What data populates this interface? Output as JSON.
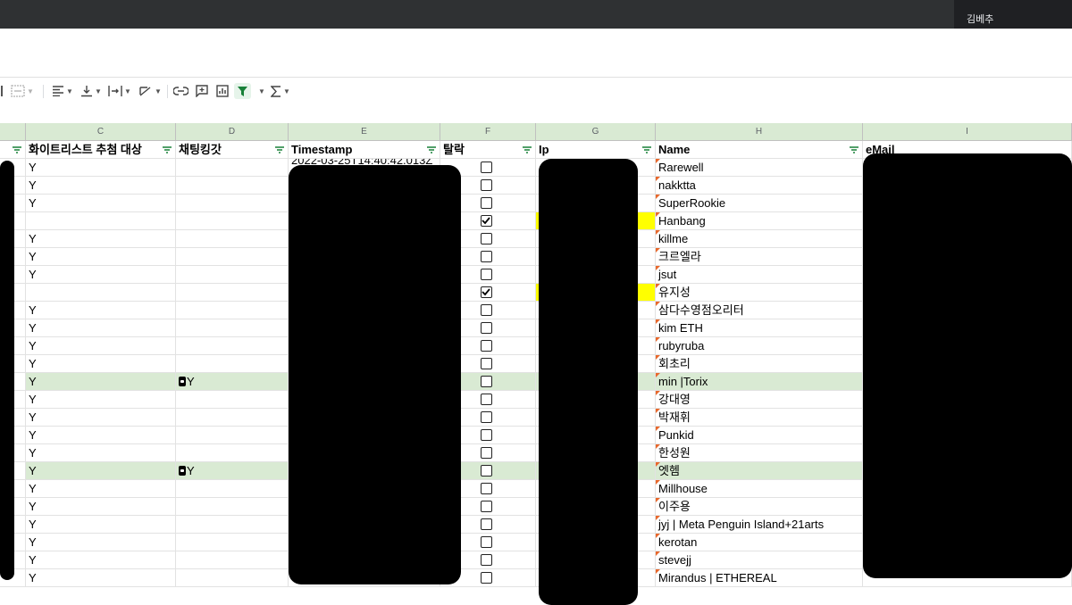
{
  "user": {
    "name": "김베추"
  },
  "columns": {
    "letters": [
      "C",
      "D",
      "E",
      "F",
      "G",
      "H",
      "I"
    ]
  },
  "headers": {
    "c": "화이트리스트 추첨 대상",
    "d": "채팅킹갓",
    "e": "Timestamp",
    "f": "탈락",
    "g": "Ip",
    "h": "Name",
    "i": "eMail"
  },
  "timestamp_partial": "2022-03-25T14:40:42.013Z",
  "rows": [
    {
      "c": "Y",
      "d": "",
      "f": false,
      "name": "Rarewell",
      "hl": ""
    },
    {
      "c": "Y",
      "d": "",
      "f": false,
      "name": "nakktta",
      "hl": ""
    },
    {
      "c": "Y",
      "d": "",
      "f": false,
      "name": "SuperRookie",
      "hl": ""
    },
    {
      "c": "",
      "d": "",
      "f": true,
      "name": "Hanbang",
      "hl": "yellow"
    },
    {
      "c": "Y",
      "d": "",
      "f": false,
      "name": "killme",
      "hl": ""
    },
    {
      "c": "Y",
      "d": "",
      "f": false,
      "name": "크르엘라",
      "hl": ""
    },
    {
      "c": "Y",
      "d": "",
      "f": false,
      "name": "jsut",
      "hl": ""
    },
    {
      "c": "",
      "d": "",
      "f": true,
      "name": "유지성",
      "hl": "yellow"
    },
    {
      "c": "Y",
      "d": "",
      "f": false,
      "name": "삼다수영점오리터",
      "hl": ""
    },
    {
      "c": "Y",
      "d": "",
      "f": false,
      "name": "kim ETH",
      "hl": ""
    },
    {
      "c": "Y",
      "d": "",
      "f": false,
      "name": "rubyruba",
      "hl": ""
    },
    {
      "c": "Y",
      "d": "",
      "f": false,
      "name": "회초리",
      "hl": ""
    },
    {
      "c": "Y",
      "d": "Y",
      "f": false,
      "name": "min |Torix",
      "hl": "green"
    },
    {
      "c": "Y",
      "d": "",
      "f": false,
      "name": "강대영",
      "hl": ""
    },
    {
      "c": "Y",
      "d": "",
      "f": false,
      "name": "박재휘",
      "hl": ""
    },
    {
      "c": "Y",
      "d": "",
      "f": false,
      "name": "Punkid",
      "hl": ""
    },
    {
      "c": "Y",
      "d": "",
      "f": false,
      "name": "한성원",
      "hl": ""
    },
    {
      "c": "Y",
      "d": "Y",
      "f": false,
      "name": "엣헴",
      "hl": "green"
    },
    {
      "c": "Y",
      "d": "",
      "f": false,
      "name": "Millhouse",
      "hl": ""
    },
    {
      "c": "Y",
      "d": "",
      "f": false,
      "name": "이주용",
      "hl": ""
    },
    {
      "c": "Y",
      "d": "",
      "f": false,
      "name": "jyj | Meta Penguin Island+21arts",
      "hl": ""
    },
    {
      "c": "Y",
      "d": "",
      "f": false,
      "name": "kerotan",
      "hl": ""
    },
    {
      "c": "Y",
      "d": "",
      "f": false,
      "name": "stevejj",
      "hl": ""
    },
    {
      "c": "Y",
      "d": "",
      "f": false,
      "name": "Mirandus | ETHEREAL",
      "hl": ""
    }
  ],
  "colors": {
    "header_band": "#d9ead3",
    "yellow": "#ffff00",
    "filter_icon": "#188038"
  }
}
